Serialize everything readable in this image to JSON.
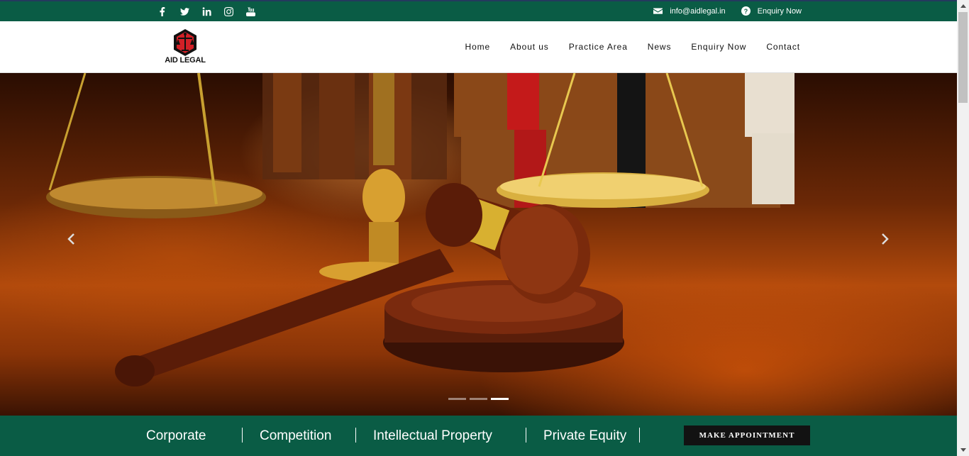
{
  "topbar": {
    "social_icons": [
      "facebook-icon",
      "twitter-icon",
      "linkedin-icon",
      "instagram-icon",
      "youtube-icon"
    ],
    "email": "info@aidlegal.in",
    "enquiry": "Enquiry Now"
  },
  "header": {
    "logo_text": "AID LEGAL",
    "nav": [
      "Home",
      "About us",
      "Practice Area",
      "News",
      "Enquiry Now",
      "Contact"
    ]
  },
  "hero": {
    "slide_count": 3,
    "active_slide": 3
  },
  "practice_areas": [
    "Corporate",
    "Competition",
    "Intellectual Property",
    "Private Equity"
  ],
  "appointment_button": "MAKE APPOINTMENT",
  "colors": {
    "brand_green": "#0a5c45",
    "logo_red": "#d32027",
    "button_dark": "#121212"
  }
}
